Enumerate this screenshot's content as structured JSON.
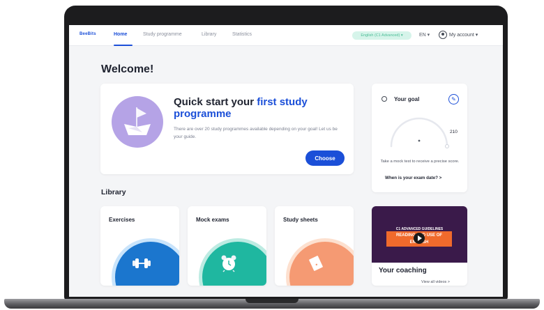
{
  "nav": {
    "logo": "BeeBits",
    "links": [
      "Home",
      "Study programme",
      "Library",
      "Statistics"
    ],
    "level": "English (C1 Advanced) ▾",
    "language": "EN ▾",
    "account": "My account ▾"
  },
  "main": {
    "welcome": "Welcome!",
    "quick_start": {
      "title_plain": "Quick start your ",
      "title_highlight": "first study programme",
      "description": "There are over 20 study programmes available depending on your goal! Let us be your guide.",
      "button": "Choose"
    },
    "goal": {
      "title": "Your goal",
      "score": "210",
      "message": "Take a mock test to receive a precise score.",
      "link": "When is your exam date?  >"
    },
    "library": {
      "title": "Library",
      "items": [
        {
          "label": "Exercises",
          "icon": "dumbbell-icon"
        },
        {
          "label": "Mock exams",
          "icon": "alarm-clock-icon"
        },
        {
          "label": "Study sheets",
          "icon": "document-icon"
        }
      ]
    },
    "coaching": {
      "video_top": "C1 ADVANCED GUIDELINES",
      "video_band": "READING AND USE OF ENGLISH",
      "title": "Your coaching",
      "link": "View all videos >"
    }
  },
  "colors": {
    "accent": "#1b4fd8",
    "level_pill_bg": "#d6f4ea",
    "boat_circle": "#b5a3e6",
    "exercises": "#1b76ce",
    "mock_exams": "#1fb7a0",
    "study_sheets": "#f59a73",
    "video_bg": "#3a1a4a",
    "video_band": "#f06a2c"
  }
}
